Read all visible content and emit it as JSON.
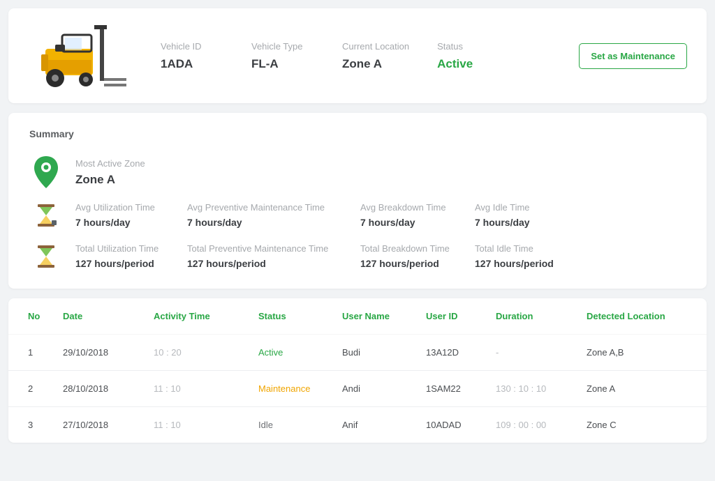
{
  "header": {
    "fields": [
      {
        "label": "Vehicle ID",
        "value": "1ADA"
      },
      {
        "label": "Vehicle Type",
        "value": "FL-A"
      },
      {
        "label": "Current Location",
        "value": "Zone A"
      },
      {
        "label": "Status",
        "value": "Active",
        "status": true
      }
    ],
    "button": "Set as Maintenance"
  },
  "summary": {
    "title": "Summary",
    "zone": {
      "label": "Most Active Zone",
      "value": "Zone A"
    },
    "avg": [
      {
        "label": "Avg Utilization Time",
        "value": "7 hours/day"
      },
      {
        "label": "Avg Preventive Maintenance Time",
        "value": "7 hours/day"
      },
      {
        "label": "Avg Breakdown Time",
        "value": "7 hours/day"
      },
      {
        "label": "Avg Idle Time",
        "value": "7 hours/day"
      }
    ],
    "total": [
      {
        "label": "Total Utilization Time",
        "value": "127 hours/period"
      },
      {
        "label": "Total Preventive Maintenance Time",
        "value": "127 hours/period"
      },
      {
        "label": "Total Breakdown Time",
        "value": "127 hours/period"
      },
      {
        "label": "Total Idle Time",
        "value": "127 hours/period"
      }
    ]
  },
  "table": {
    "headers": [
      "No",
      "Date",
      "Activity Time",
      "Status",
      "User Name",
      "User ID",
      "Duration",
      "Detected Location"
    ],
    "rows": [
      {
        "no": "1",
        "date": "29/10/2018",
        "act": "10 : 20",
        "status": "Active",
        "status_cls": "st-active",
        "uname": "Budi",
        "uid": "13A12D",
        "dur": "-",
        "loc": "Zone A,B"
      },
      {
        "no": "2",
        "date": "28/10/2018",
        "act": "11 : 10",
        "status": "Maintenance",
        "status_cls": "st-maint",
        "uname": "Andi",
        "uid": "1SAM22",
        "dur": "130 : 10 : 10",
        "loc": "Zone A"
      },
      {
        "no": "3",
        "date": "27/10/2018",
        "act": "11 : 10",
        "status": "Idle",
        "status_cls": "st-idle",
        "uname": "Anif",
        "uid": "10ADAD",
        "dur": "109 : 00 : 00",
        "loc": "Zone C"
      }
    ]
  }
}
